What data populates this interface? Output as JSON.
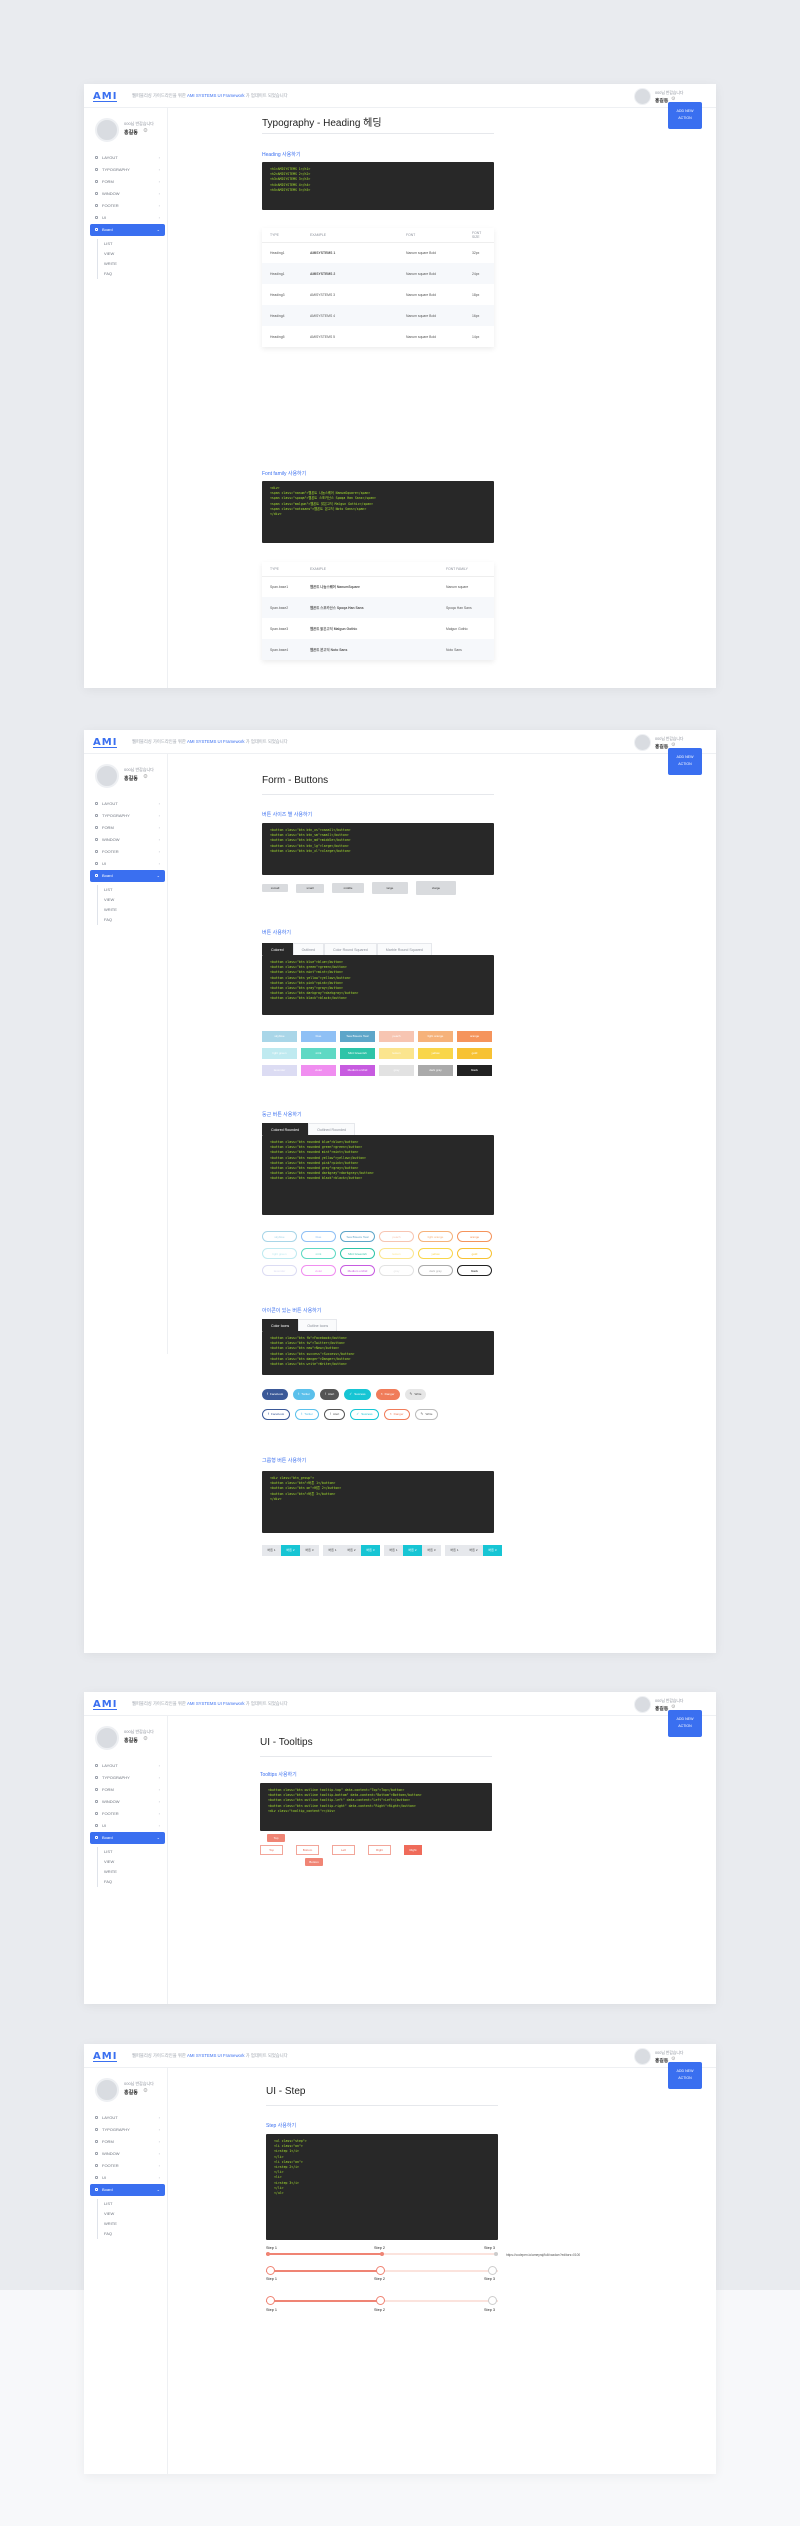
{
  "app": {
    "logo": "AMI",
    "topbar_prefix": "웹퍼블리싱 가이드라인을 위한 ",
    "topbar_highlight": "AMI SYSTEMS UI Framework",
    "topbar_suffix": " 가 업데이트 되었습니다",
    "user_small": "000님 반갑습니다",
    "user_name": "홍길동",
    "action_button_line1": "ADD NEW",
    "action_button_line2": "ACTION"
  },
  "menu": {
    "items": [
      {
        "label": "LAYOUT"
      },
      {
        "label": "TYPOGRAPHY"
      },
      {
        "label": "FORM"
      },
      {
        "label": "WINDOW"
      },
      {
        "label": "FOOTER"
      },
      {
        "label": "UI"
      },
      {
        "label": "Board"
      }
    ],
    "submenu": [
      "LIST",
      "VIEW",
      "WRITE",
      "FAQ"
    ]
  },
  "typography": {
    "title": "Typography - Heading 헤딩",
    "heading_section": "Heading 사용하기",
    "heading_code": [
      "<h1>AMISYSTEMS 1</h1>",
      "<h2>AMISYSTEMS 2</h2>",
      "<h3>AMISYSTEMS 3</h3>",
      "<h4>AMISYSTEMS 4</h4>",
      "<h5>AMISYSTEMS 5</h5>"
    ],
    "heading_table": {
      "headers": [
        "TYPE",
        "EXAMPLE",
        "FONT",
        "FONT SIZE"
      ],
      "rows": [
        [
          "Heading1",
          "AMISYSTEMS 1",
          "Nanum square Bold",
          "32px"
        ],
        [
          "Heading1",
          "AMISYSTEMS 2",
          "Nanum square Bold",
          "24px"
        ],
        [
          "Heading3",
          "AMISYSTEMS 3",
          "Nanum square Bold",
          "18px"
        ],
        [
          "Heading4",
          "AMISYSTEMS 4",
          "Nanum square Bold",
          "16px"
        ],
        [
          "Heading5",
          "AMISYSTEMS 5",
          "Nanum square Bold",
          "14px"
        ]
      ]
    },
    "font_section": "Font family 사용하기",
    "font_code": [
      "<div>",
      "  <span class=\"nanum\">웹폰트 나눔스퀘어 NanumSquare</span>",
      "  <span class=\"spoqa\">웹폰트 스포카산스 Spoqa Han Sans</span>",
      "  <span class=\"malgun\">웹폰트 맑은고딕 Malgun Gothic</span>",
      "  <span class=\"notosans\">웹폰트 본고딕 Noto Sans</span>",
      "</div>"
    ],
    "font_table": {
      "headers": [
        "TYPE",
        "EXAMPLE",
        "FONT FAMILY"
      ],
      "rows": [
        [
          "Span.base1",
          "웹폰트 나눔스퀘어 NanumSquare",
          "Nanum square"
        ],
        [
          "Span.base2",
          "웹폰트 스포카산스 Spoqa Han Sans",
          "Spoqa Han Sans"
        ],
        [
          "Span.base3",
          "웹폰트 맑은고딕 Malgun Gothic",
          "Malgun Gothic"
        ],
        [
          "Span.base4",
          "웹폰트 본고딕 Noto Sans",
          "Noto Sans"
        ]
      ]
    }
  },
  "buttons": {
    "title": "Form - Buttons",
    "size_section": "버튼 사이즈 별 사용하기",
    "size_code": [
      "<button class=\"btn btn_xs\">xsmall</button>",
      "<button class=\"btn btn_sm\">small</button>",
      "<button class=\"btn btn_md\">middle</button>",
      "<button class=\"btn btn_lg\">large</button>",
      "<button class=\"btn btn_xl\">xlarge</button>"
    ],
    "size_buttons": [
      "xsmall",
      "small",
      "middle",
      "large",
      "xlarge"
    ],
    "color_section": "버튼 사용하기",
    "color_tabs": [
      "Colored",
      "Outlined",
      "Color Round Squared",
      "Marble Round Squared"
    ],
    "color_code": [
      "<button class=\"btn blue\">blue</button>",
      "<button class=\"btn green\">green</button>",
      "<button class=\"btn mint\">mint</button>",
      "<button class=\"btn yellow\">yellow</button>",
      "<button class=\"btn pink\">pink</button>",
      "<button class=\"btn gray\">gray</button>",
      "<button class=\"btn darkgray\">darkgray</button>",
      "<button class=\"btn black\">black</button>"
    ],
    "color_rows": [
      [
        {
          "label": "skyblue",
          "color": "#a9d6e8"
        },
        {
          "label": "blue",
          "color": "#8fc0f5"
        },
        {
          "label": "Sea Breeze Teal",
          "color": "#5ea6c9"
        },
        {
          "label": "peach",
          "color": "#f7c5b2"
        },
        {
          "label": "light orange",
          "color": "#f6b27a"
        },
        {
          "label": "orange",
          "color": "#f5945c"
        }
      ],
      [
        {
          "label": "light green",
          "color": "#bfeaf0"
        },
        {
          "label": "mint",
          "color": "#5fd9c4"
        },
        {
          "label": "Mint Greenish",
          "color": "#2ec4a8"
        },
        {
          "label": "lemon",
          "color": "#fbe58e"
        },
        {
          "label": "yellow",
          "color": "#f9d64a"
        },
        {
          "label": "gold",
          "color": "#f7c233"
        }
      ],
      [
        {
          "label": "lavender",
          "color": "#dcdcf3"
        },
        {
          "label": "violet",
          "color": "#f08ef0"
        },
        {
          "label": "Medium orchid",
          "color": "#c75be0"
        },
        {
          "label": "gray",
          "color": "#e2e2e2"
        },
        {
          "label": "dark gray",
          "color": "#aaaaaa"
        },
        {
          "label": "black",
          "color": "#222222"
        }
      ]
    ],
    "round_section": "둥근 버튼 사용하기",
    "round_tabs": [
      "Colored Rounded",
      "Outlined Rounded"
    ],
    "round_code": [
      "<button class=\"btn rounded blue\">blue</button>",
      "<button class=\"btn rounded green\">green</button>",
      "<button class=\"btn rounded mint\">mint</button>",
      "<button class=\"btn rounded yellow\">yellow</button>",
      "<button class=\"btn rounded pink\">pink</button>",
      "<button class=\"btn rounded gray\">gray</button>",
      "<button class=\"btn rounded darkgray\">darkgray</button>",
      "<button class=\"btn rounded black\">black</button>"
    ],
    "icon_section": "아이콘이 있는 버튼 사용하기",
    "icon_tabs": [
      "Color Icons",
      "Outline Icons"
    ],
    "icon_code": [
      "<button class=\"btn fb\">Facebook</button>",
      "<button class=\"btn tw\">Twitter</button>",
      "<button class=\"btn new\">New</button>",
      "<button class=\"btn success\">Success</button>",
      "<button class=\"btn danger\">Danger</button>",
      "<button class=\"btn write\">Write</button>"
    ],
    "icon_buttons": [
      {
        "label": "Facebook",
        "glyph": "f",
        "color": "#3b5998"
      },
      {
        "label": "Twitter",
        "glyph": "t",
        "color": "#5bc0eb"
      },
      {
        "label": "Alert",
        "glyph": "!",
        "color": "#555555"
      },
      {
        "label": "Success",
        "glyph": "✓",
        "color": "#17c5d4"
      },
      {
        "label": "Danger",
        "glyph": "×",
        "color": "#f07c5a"
      },
      {
        "label": "Write",
        "glyph": "✎",
        "color": "#e6e6e6"
      }
    ],
    "group_section": "그룹형 버튼 사용하기",
    "group_code": [
      "<div class=\"btn_group\">",
      "  <button class=\"btn\">버튼 1</button>",
      "  <button class=\"btn on\">버튼 2</button>",
      "  <button class=\"btn\">버튼 3</button>",
      "</div>"
    ],
    "group_buttons": [
      "버튼 1",
      "버튼 2",
      "버튼 3"
    ]
  },
  "tooltips": {
    "title": "UI - Tooltips",
    "section": "Tooltips 사용하기",
    "code": [
      "<button class=\"btn outline tooltip-top\" data-content=\"Top\">Top</button>",
      "<button class=\"btn outline tooltip-bottom\" data-content=\"Bottom\">Bottom</button>",
      "<button class=\"btn outline tooltip-left\" data-content=\"Left\">Left</button>",
      "<button class=\"btn outline tooltip-right\" data-content=\"Right\">Right</button>",
      "<div class=\"tooltip_content\"></div>"
    ],
    "buttons": [
      "Top",
      "Bottom",
      "Left",
      "Right"
    ],
    "tip_top": "Top",
    "tip_bottom": "Bottom"
  },
  "step": {
    "title": "UI - Step",
    "section": "Step 사용하기",
    "code": [
      "<ul class=\"step\">",
      "  <li class=\"on\">",
      "    <i>step 1</i>",
      "  </li>",
      "  <li class=\"on\">",
      "    <i>step 2</i>",
      "  </li>",
      "  <li>",
      "    <i>step 3</i>",
      "  </li>",
      "</ul>"
    ],
    "labels": [
      "Step 1",
      "Step 2",
      "Step 3"
    ],
    "url_note": "https://codepen.io/ameyraj/full/xazdwv?editors=0100"
  }
}
